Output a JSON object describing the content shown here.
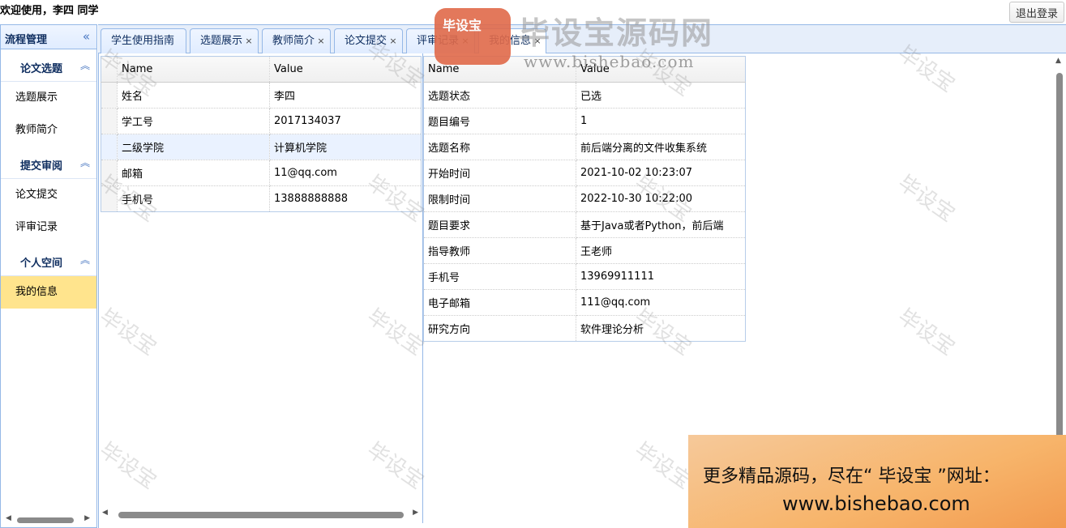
{
  "header": {
    "welcome": "欢迎使用，李四 同学",
    "logout_label": "退出登录"
  },
  "sidebar": {
    "title": "流程管理",
    "groups": [
      {
        "label": "论文选题",
        "items": [
          "选题展示",
          "教师简介"
        ]
      },
      {
        "label": "提交审阅",
        "items": [
          "论文提交",
          "评审记录"
        ]
      },
      {
        "label": "个人空间",
        "items": [
          "我的信息"
        ]
      }
    ],
    "active_item": "我的信息"
  },
  "tabs": [
    {
      "label": "学生使用指南"
    },
    {
      "label": "选题展示"
    },
    {
      "label": "教师简介"
    },
    {
      "label": "论文提交"
    },
    {
      "label": "评审记录"
    },
    {
      "label": "我的信息"
    }
  ],
  "left_grid": {
    "headers": [
      "Name",
      "Value"
    ],
    "rows": [
      [
        "姓名",
        "李四"
      ],
      [
        "学工号",
        "2017134037"
      ],
      [
        "二级学院",
        "计算机学院"
      ],
      [
        "邮箱",
        "11@qq.com"
      ],
      [
        "手机号",
        "13888888888"
      ]
    ]
  },
  "right_grid": {
    "headers": [
      "Name",
      "Value"
    ],
    "rows": [
      [
        "选题状态",
        "已选"
      ],
      [
        "题目编号",
        "1"
      ],
      [
        "选题名称",
        "前后端分离的文件收集系统"
      ],
      [
        "开始时间",
        "2021-10-02 10:23:07"
      ],
      [
        "限制时间",
        "2022-10-30 10:22:00"
      ],
      [
        "题目要求",
        "基于Java或者Python，前后端"
      ],
      [
        "指导教师",
        "王老师"
      ],
      [
        "手机号",
        "13969911111"
      ],
      [
        "电子邮箱",
        "111@qq.com"
      ],
      [
        "研究方向",
        "软件理论分析"
      ]
    ]
  },
  "watermark": {
    "text": "毕设宝",
    "logo_badge": "毕设宝",
    "logo_title": "毕设宝源码网",
    "logo_url": "www.bishebao.com"
  },
  "ad": {
    "line1": "更多精品源码，尽在“ 毕设宝 ”网址：",
    "line2": "www.bishebao.com"
  }
}
